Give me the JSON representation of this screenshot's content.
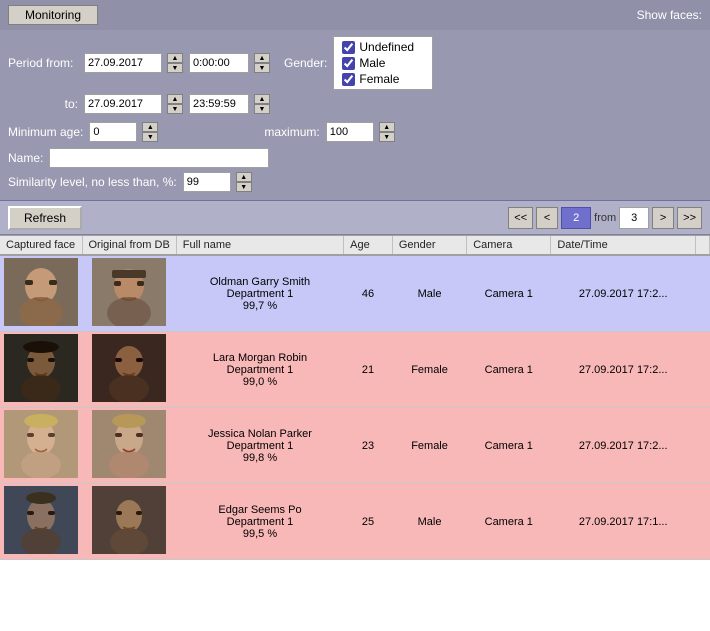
{
  "header": {
    "title": "Monitoring",
    "show_faces_label": "Show faces:"
  },
  "filter": {
    "period_from_label": "Period from:",
    "to_label": "to:",
    "date_from": "27.09.2017",
    "date_to": "27.09.2017",
    "time_from": "0:00:00",
    "time_to": "23:59:59",
    "gender_label": "Gender:",
    "gender_options": [
      {
        "label": "Undefined",
        "checked": true
      },
      {
        "label": "Male",
        "checked": true
      },
      {
        "label": "Female",
        "checked": true
      }
    ],
    "min_age_label": "Minimum age:",
    "max_age_label": "maximum:",
    "min_age": "0",
    "max_age": "100",
    "name_label": "Name:",
    "similarity_label": "Similarity level, no less than, %:",
    "similarity_value": "99"
  },
  "toolbar": {
    "refresh_label": "Refresh",
    "page_current": "2",
    "from_label": "from",
    "page_total": "3",
    "nav_first": "<<",
    "nav_prev": "<",
    "nav_next": ">",
    "nav_last": ">>"
  },
  "table": {
    "columns": [
      "Captured face",
      "Original from DB",
      "Full name",
      "Age",
      "Gender",
      "Camera",
      "Date/Time"
    ],
    "rows": [
      {
        "row_type": "blue",
        "full_name": "Oldman Garry Smith\nDepartment 1\n99,7 %",
        "full_name_display": "Oldman Garry Smith Department 1 99,7 %",
        "age": "46",
        "gender": "Male",
        "camera": "Camera 1",
        "datetime": "27.09.2017 17:2...",
        "face_captured_class": "face-captured-1",
        "face_db_class": "face-db-1"
      },
      {
        "row_type": "pink",
        "full_name_display": "Lara Morgan Robin Department 1 99,0 %",
        "age": "21",
        "gender": "Female",
        "camera": "Camera 1",
        "datetime": "27.09.2017 17:2...",
        "face_captured_class": "face-captured-2",
        "face_db_class": "face-db-2"
      },
      {
        "row_type": "pink",
        "full_name_display": "Jessica Nolan Parker Department 1 99,8 %",
        "age": "23",
        "gender": "Female",
        "camera": "Camera 1",
        "datetime": "27.09.2017 17:2...",
        "face_captured_class": "face-captured-3",
        "face_db_class": "face-db-3"
      },
      {
        "row_type": "pink",
        "full_name_display": "Edgar Seems Po Department 1 99,5 %",
        "age": "25",
        "gender": "Male",
        "camera": "Camera 1",
        "datetime": "27.09.2017 17:1...",
        "face_captured_class": "face-captured-4",
        "face_db_class": "face-db-4"
      }
    ]
  }
}
